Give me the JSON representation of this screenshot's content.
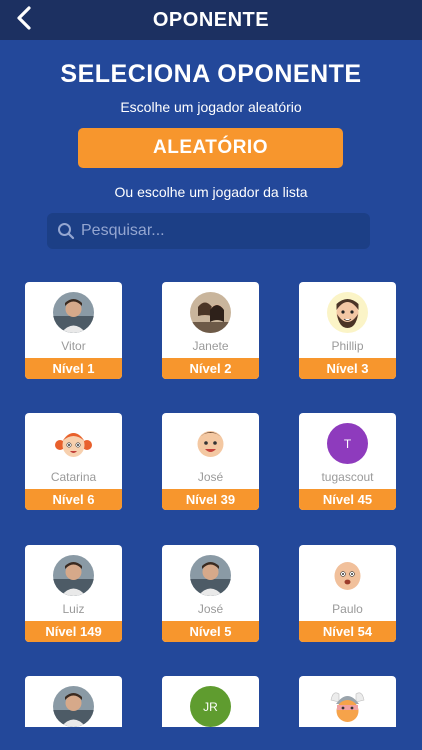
{
  "header": {
    "title": "OPONENTE",
    "back_icon": "chevron-left-icon"
  },
  "main": {
    "heading": "SELECIONA OPONENTE",
    "random_hint": "Escolhe um jogador aleatório",
    "random_button": "ALEATÓRIO",
    "list_hint": "Ou escolhe um jogador da lista",
    "search": {
      "placeholder": "Pesquisar...",
      "value": ""
    }
  },
  "colors": {
    "background": "#23489a",
    "topbar": "#1c3061",
    "accent": "#f7962d"
  },
  "opponents": [
    {
      "name": "Vitor",
      "level": "Nível 1",
      "avatar": "photo-man-icon"
    },
    {
      "name": "Janete",
      "level": "Nível 2",
      "avatar": "photo-couple-icon"
    },
    {
      "name": "Phillip",
      "level": "Nível 3",
      "avatar": "cartoon-bearded-man-icon"
    },
    {
      "name": "Catarina",
      "level": "Nível 6",
      "avatar": "cartoon-girl-icon"
    },
    {
      "name": "José",
      "level": "Nível 39",
      "avatar": "cartoon-boy-icon"
    },
    {
      "name": "tugascout",
      "level": "Nível 45",
      "avatar": "initial-avatar",
      "initials": "T",
      "color": "#8e3bbd"
    },
    {
      "name": "Luiz",
      "level": "Nível 149",
      "avatar": "photo-man-icon"
    },
    {
      "name": "José",
      "level": "Nível 5",
      "avatar": "photo-man-icon"
    },
    {
      "name": "Paulo",
      "level": "Nível 54",
      "avatar": "cartoon-bald-man-icon"
    },
    {
      "name": "",
      "level": "",
      "avatar": "photo-man-icon"
    },
    {
      "name": "",
      "level": "",
      "avatar": "initial-avatar",
      "initials": "JR",
      "color": "#5f9c2f"
    },
    {
      "name": "",
      "level": "",
      "avatar": "cartoon-viking-icon"
    }
  ]
}
